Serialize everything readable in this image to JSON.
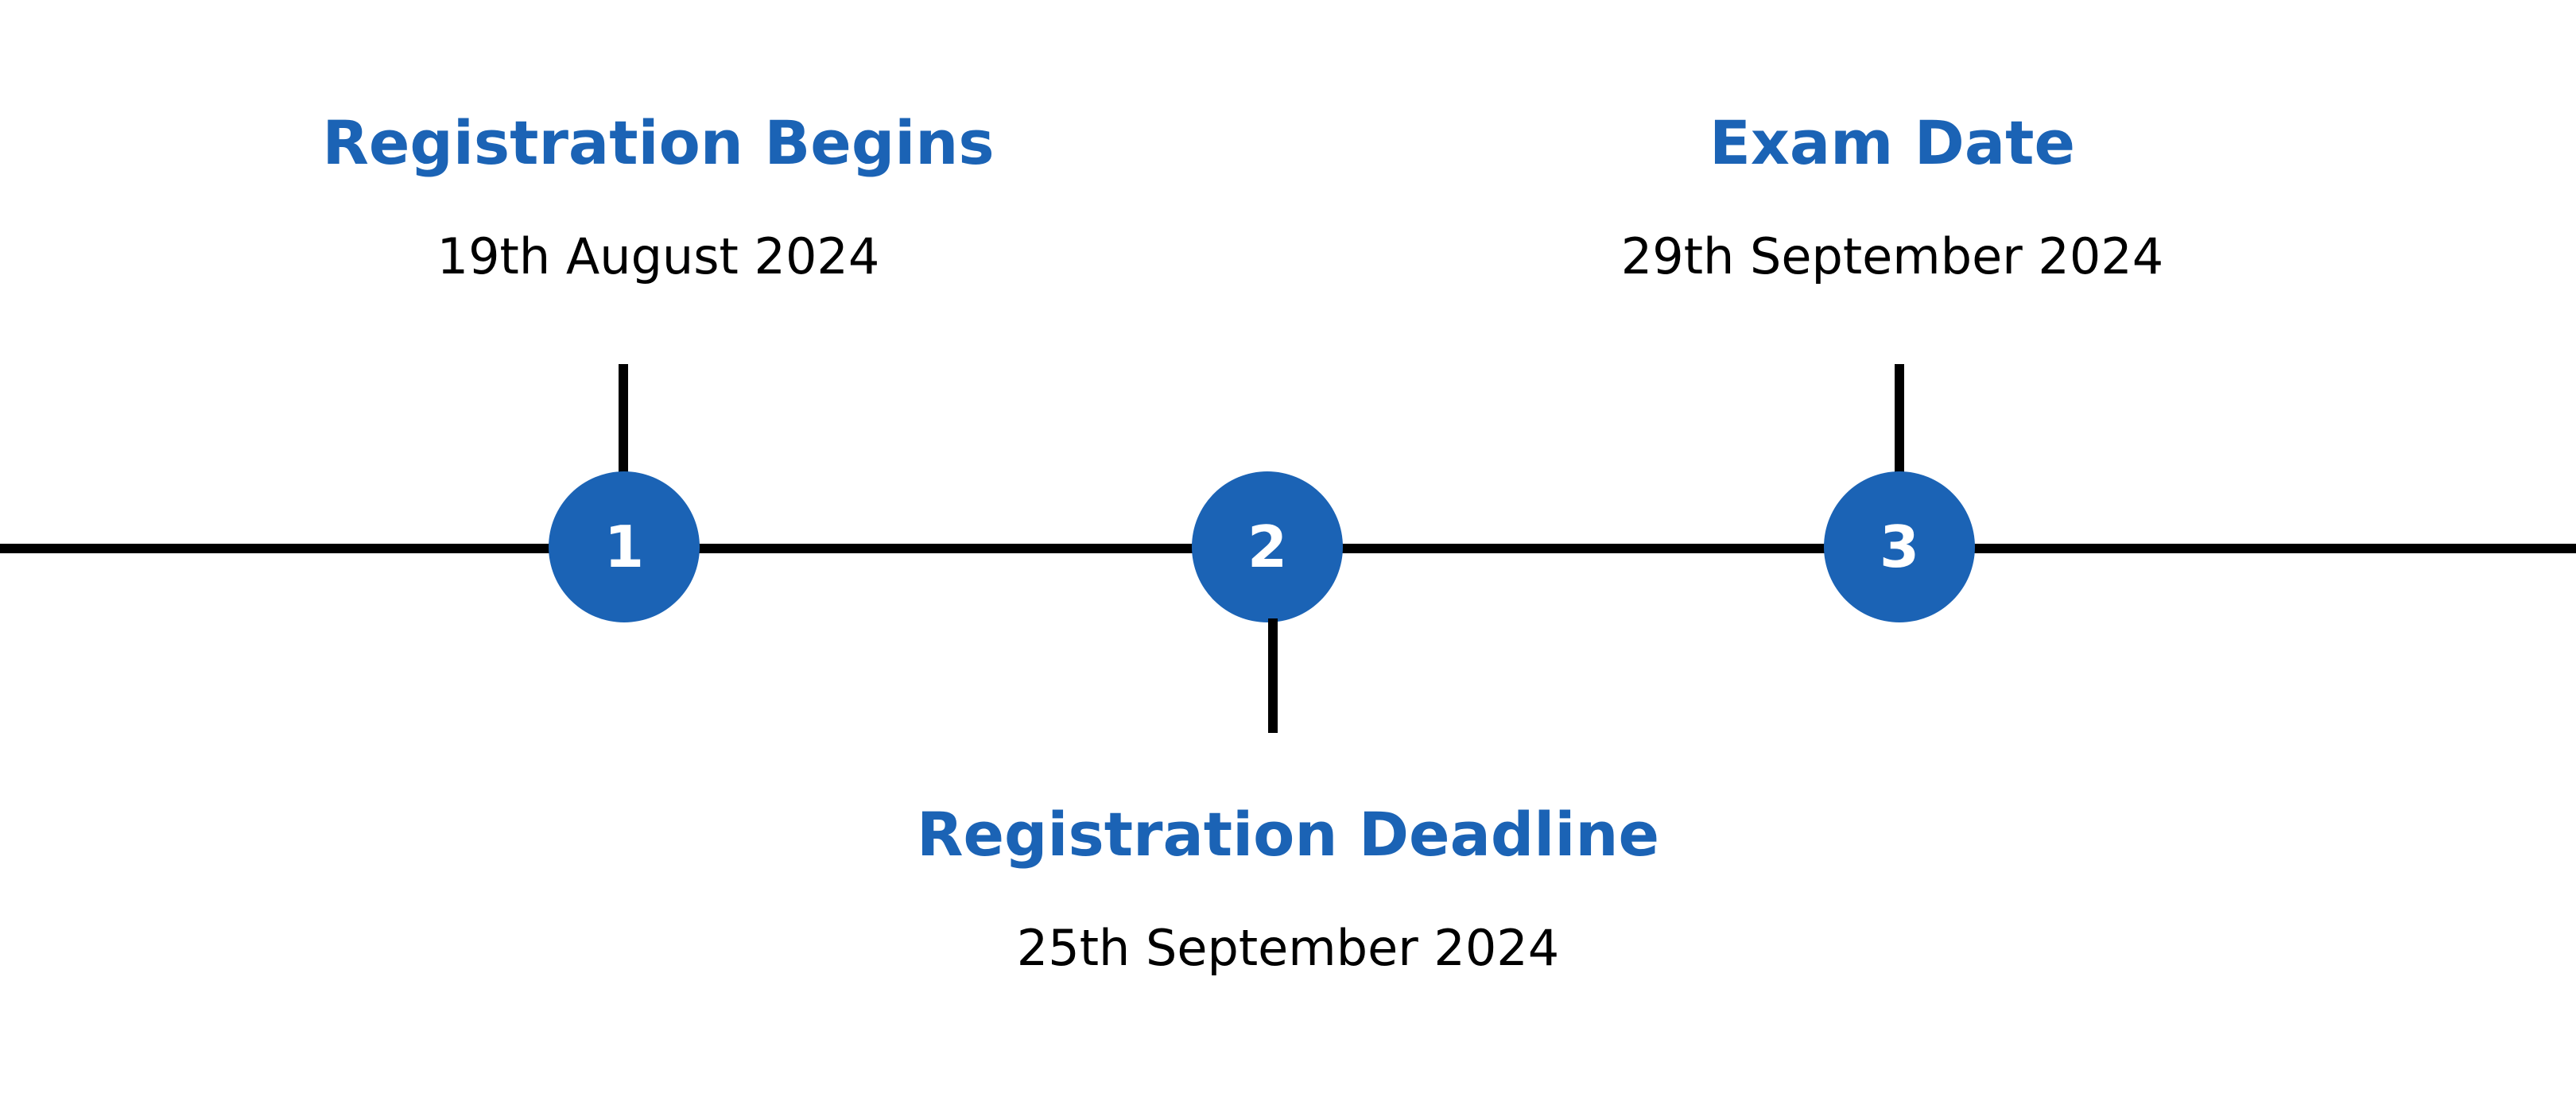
{
  "colors": {
    "accent": "#1b63b5",
    "line": "#000000",
    "text": "#000000",
    "background": "#ffffff"
  },
  "events": [
    {
      "number": "1",
      "title": "Registration Begins",
      "date": "19th August 2024"
    },
    {
      "number": "2",
      "title": "Registration Deadline",
      "date": "25th September 2024"
    },
    {
      "number": "3",
      "title": "Exam Date",
      "date": "29th September 2024"
    }
  ]
}
